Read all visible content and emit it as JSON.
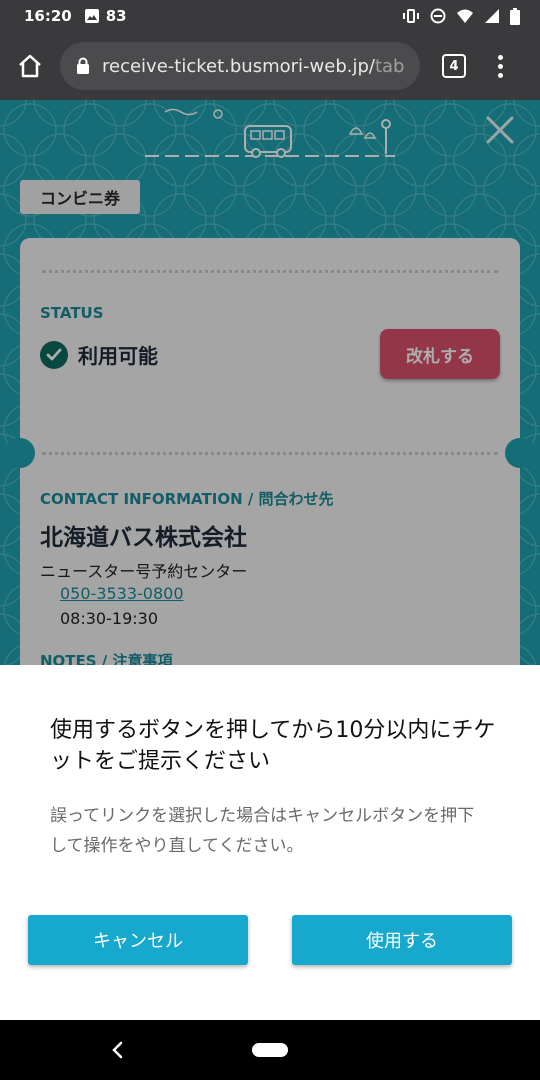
{
  "status_bar": {
    "time": "16:20",
    "notification_count": "83",
    "icons": [
      "image-icon",
      "vibrate-icon",
      "dnd-icon",
      "wifi-icon",
      "signal-icon",
      "battery-icon"
    ]
  },
  "browser": {
    "url_main": "receive-ticket.busmori-web.jp/",
    "url_rest": "tab",
    "tab_count": "4"
  },
  "ticket": {
    "type_label": "コンビニ券",
    "status_label": "STATUS",
    "status_value": "利用可能",
    "use_button": "改札する",
    "contact_label": "CONTACT INFORMATION / 問合わせ先",
    "company": "北海道バス株式会社",
    "center": "ニュースター号予約センター",
    "phone": "050-3533-0800",
    "hours": "08:30-19:30",
    "notes_label": "NOTES / 注意事項"
  },
  "dialog": {
    "title": "使用するボタンを押してから10分以内にチケットをご提示ください",
    "description": "誤ってリンクを選択した場合はキャンセルボタンを押下して操作をやり直してください。",
    "cancel_label": "キャンセル",
    "confirm_label": "使用する"
  },
  "colors": {
    "page_bg": "#1fa2b0",
    "accent": "#17a8cd",
    "gate_button": "#d9506b",
    "status_check": "#0e6b5f"
  }
}
